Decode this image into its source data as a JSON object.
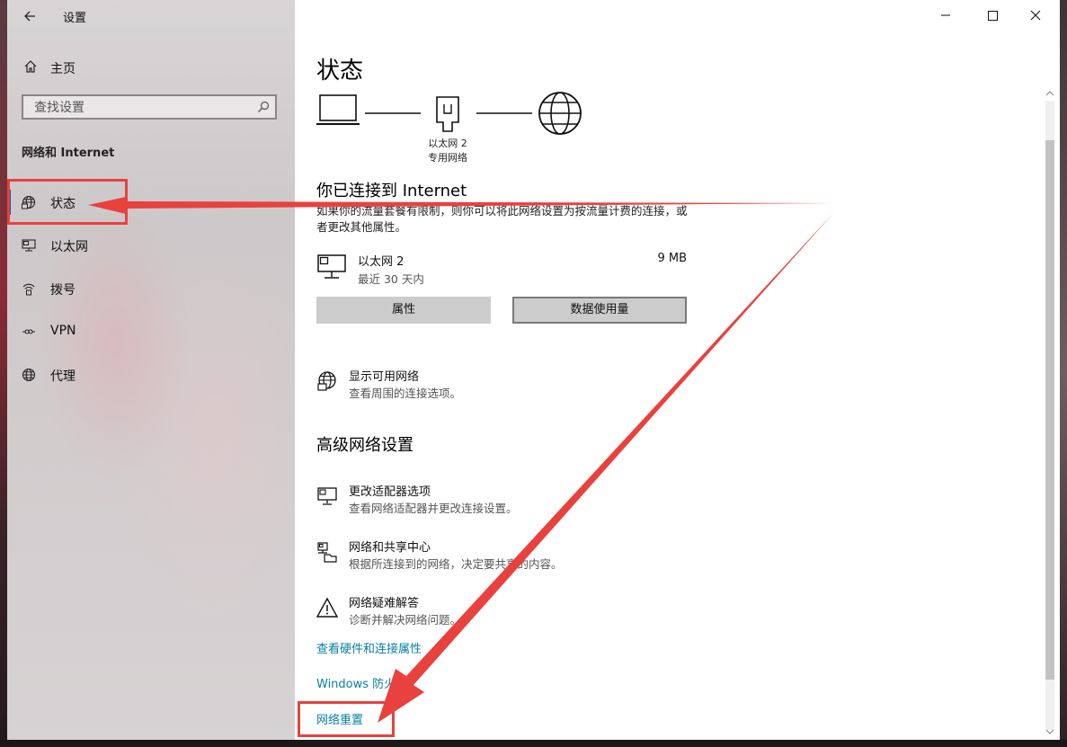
{
  "window": {
    "title": "设置"
  },
  "sidebar": {
    "home_label": "主页",
    "search_placeholder": "查找设置",
    "section_title": "网络和 Internet",
    "items": [
      {
        "label": "状态",
        "icon": "globe-status-icon",
        "selected": true
      },
      {
        "label": "以太网",
        "icon": "ethernet-icon"
      },
      {
        "label": "拨号",
        "icon": "dialup-icon"
      },
      {
        "label": "VPN",
        "icon": "vpn-icon"
      },
      {
        "label": "代理",
        "icon": "globe-icon"
      }
    ]
  },
  "main": {
    "page_title": "状态",
    "diagram": {
      "adapter_name": "以太网 2",
      "network_type": "专用网络"
    },
    "connected_heading": "你已连接到 Internet",
    "connected_desc": "如果你的流量套餐有限制，则你可以将此网络设置为按流量计费的连接，或者更改其他属性。",
    "adapter": {
      "name": "以太网 2",
      "period": "最近 30 天内",
      "usage": "9 MB"
    },
    "buttons": {
      "properties": "属性",
      "data_usage": "数据使用量"
    },
    "show_networks": {
      "title": "显示可用网络",
      "subtitle": "查看周围的连接选项。"
    },
    "advanced_heading": "高级网络设置",
    "advanced_items": [
      {
        "title": "更改适配器选项",
        "subtitle": "查看网络适配器并更改连接设置。",
        "icon": "adapter-icon"
      },
      {
        "title": "网络和共享中心",
        "subtitle": "根据所连接到的网络，决定要共享的内容。",
        "icon": "sharing-icon"
      },
      {
        "title": "网络疑难解答",
        "subtitle": "诊断并解决网络问题。",
        "icon": "warning-icon"
      }
    ],
    "links": [
      "查看硬件和连接属性",
      "Windows 防火墙",
      "网络重置"
    ]
  },
  "annotation": {
    "color": "#e8413e"
  }
}
